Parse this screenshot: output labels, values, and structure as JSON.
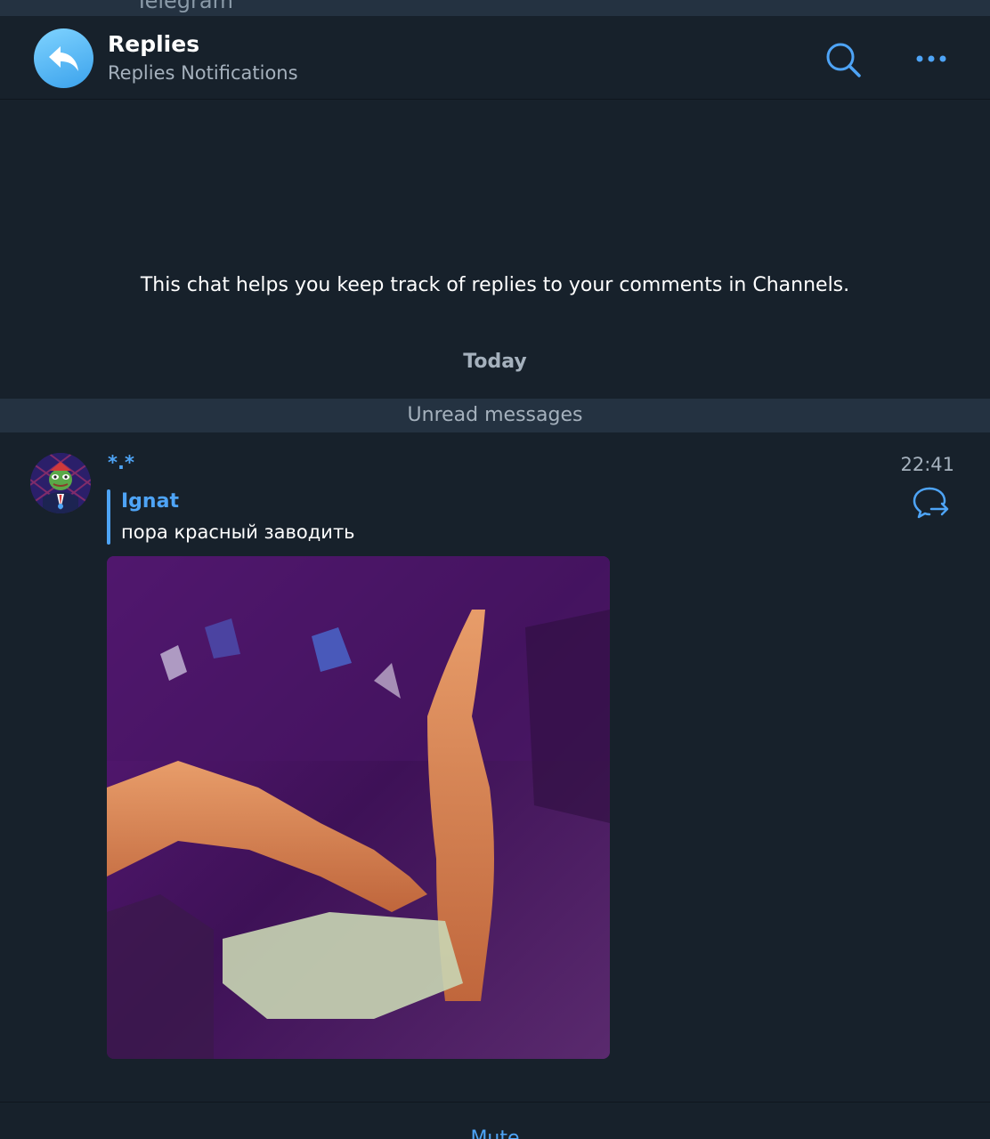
{
  "app": {
    "name": "Telegram"
  },
  "header": {
    "title": "Replies",
    "subtitle": "Replies Notifications",
    "avatar_icon": "reply-arrow-icon",
    "search_icon": "search-icon",
    "more_icon": "more-dots-icon"
  },
  "chat": {
    "info_text": "This chat helps you keep track of replies to your comments in Channels.",
    "date_label": "Today",
    "unread_label": "Unread messages"
  },
  "message": {
    "sender": "*.*",
    "time": "22:41",
    "reply_icon": "reply-forward-icon",
    "reply_to": {
      "author": "Ignat",
      "text": "пора красный заводить"
    },
    "media_type": "video"
  },
  "bottom": {
    "label": "Mute"
  },
  "colors": {
    "background": "#17212b",
    "accent": "#4ea4f6",
    "secondary_text": "#a5b1bd",
    "bar": "#243241"
  }
}
